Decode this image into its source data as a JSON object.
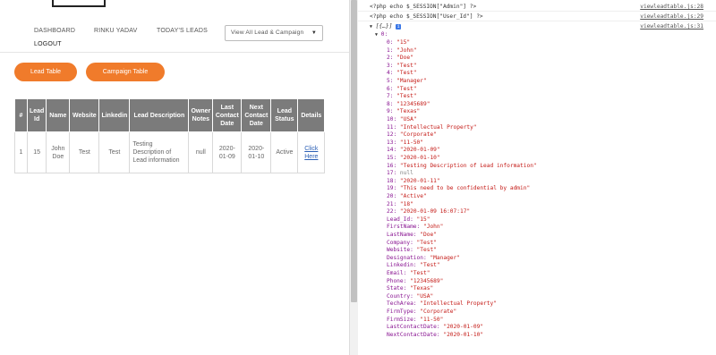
{
  "nav": {
    "dashboard": "DASHBOARD",
    "user": "RINKU YADAV",
    "today": "TODAY'S LEADS",
    "logout": "LOGOUT",
    "select_value": "View All Lead & Campaign"
  },
  "buttons": {
    "lead_table": "Lead Table",
    "campaign_table": "Campaign Table"
  },
  "table": {
    "headers": [
      "#",
      "Lead Id",
      "Name",
      "Website",
      "Linkedin",
      "Lead Description",
      "Owner Notes",
      "Last Contact Date",
      "Next Contact Date",
      "Lead Status",
      "Details"
    ],
    "rows": [
      [
        "1",
        "15",
        "John Doe",
        "Test",
        "Test",
        "Testing Description of Lead information",
        "null",
        "2020-01-09",
        "2020-01-10",
        "Active",
        "Click Here"
      ]
    ]
  },
  "console": {
    "lines": [
      {
        "msg": "<?php echo $_SESSION[\"Admin\"] ?>",
        "src": "viewleadtable.js:28"
      },
      {
        "msg": "<?php echo $_SESSION[\"User_Id\"] ?>",
        "src": "viewleadtable.js:29"
      },
      {
        "msg": "",
        "src": "viewleadtable.js:31"
      }
    ],
    "array_label": "[{…}]",
    "obj_label": "0:",
    "entries": [
      {
        "k": "0:",
        "v": "\"15\"",
        "t": "s"
      },
      {
        "k": "1:",
        "v": "\"John\"",
        "t": "s"
      },
      {
        "k": "2:",
        "v": "\"Doe\"",
        "t": "s"
      },
      {
        "k": "3:",
        "v": "\"Test\"",
        "t": "s"
      },
      {
        "k": "4:",
        "v": "\"Test\"",
        "t": "s"
      },
      {
        "k": "5:",
        "v": "\"Manager\"",
        "t": "s"
      },
      {
        "k": "6:",
        "v": "\"Test\"",
        "t": "s"
      },
      {
        "k": "7:",
        "v": "\"Test\"",
        "t": "s"
      },
      {
        "k": "8:",
        "v": "\"12345689\"",
        "t": "s"
      },
      {
        "k": "9:",
        "v": "\"Texas\"",
        "t": "s"
      },
      {
        "k": "10:",
        "v": "\"USA\"",
        "t": "s"
      },
      {
        "k": "11:",
        "v": "\"Intellectual Property\"",
        "t": "s"
      },
      {
        "k": "12:",
        "v": "\"Corporate\"",
        "t": "s"
      },
      {
        "k": "13:",
        "v": "\"11-50\"",
        "t": "s"
      },
      {
        "k": "14:",
        "v": "\"2020-01-09\"",
        "t": "s"
      },
      {
        "k": "15:",
        "v": "\"2020-01-10\"",
        "t": "s"
      },
      {
        "k": "16:",
        "v": "\"Testing Description of Lead information\"",
        "t": "s"
      },
      {
        "k": "17:",
        "v": "null",
        "t": "n"
      },
      {
        "k": "18:",
        "v": "\"2020-01-11\"",
        "t": "s"
      },
      {
        "k": "19:",
        "v": "\"This need to be confidential by admin\"",
        "t": "s"
      },
      {
        "k": "20:",
        "v": "\"Active\"",
        "t": "s"
      },
      {
        "k": "21:",
        "v": "\"18\"",
        "t": "s"
      },
      {
        "k": "22:",
        "v": "\"2020-01-09 16:07:17\"",
        "t": "s"
      },
      {
        "k": "Lead_Id:",
        "v": "\"15\"",
        "t": "s"
      },
      {
        "k": "FirstName:",
        "v": "\"John\"",
        "t": "s"
      },
      {
        "k": "LastName:",
        "v": "\"Doe\"",
        "t": "s"
      },
      {
        "k": "Company:",
        "v": "\"Test\"",
        "t": "s"
      },
      {
        "k": "Website:",
        "v": "\"Test\"",
        "t": "s"
      },
      {
        "k": "Designation:",
        "v": "\"Manager\"",
        "t": "s"
      },
      {
        "k": "Linkedin:",
        "v": "\"Test\"",
        "t": "s"
      },
      {
        "k": "Email:",
        "v": "\"Test\"",
        "t": "s"
      },
      {
        "k": "Phone:",
        "v": "\"12345689\"",
        "t": "s"
      },
      {
        "k": "State:",
        "v": "\"Texas\"",
        "t": "s"
      },
      {
        "k": "Country:",
        "v": "\"USA\"",
        "t": "s"
      },
      {
        "k": "TechArea:",
        "v": "\"Intellectual Property\"",
        "t": "s"
      },
      {
        "k": "FirmType:",
        "v": "\"Corporate\"",
        "t": "s"
      },
      {
        "k": "FirmSize:",
        "v": "\"11-50\"",
        "t": "s"
      },
      {
        "k": "LastContactDate:",
        "v": "\"2020-01-09\"",
        "t": "s"
      },
      {
        "k": "NextContactDate:",
        "v": "\"2020-01-10\"",
        "t": "s"
      }
    ]
  },
  "colors": {
    "accent": "#f07b2b",
    "table_header": "#7b7b7b",
    "link": "#2b5fb5",
    "console_key": "#881391",
    "console_string": "#c41a16"
  }
}
